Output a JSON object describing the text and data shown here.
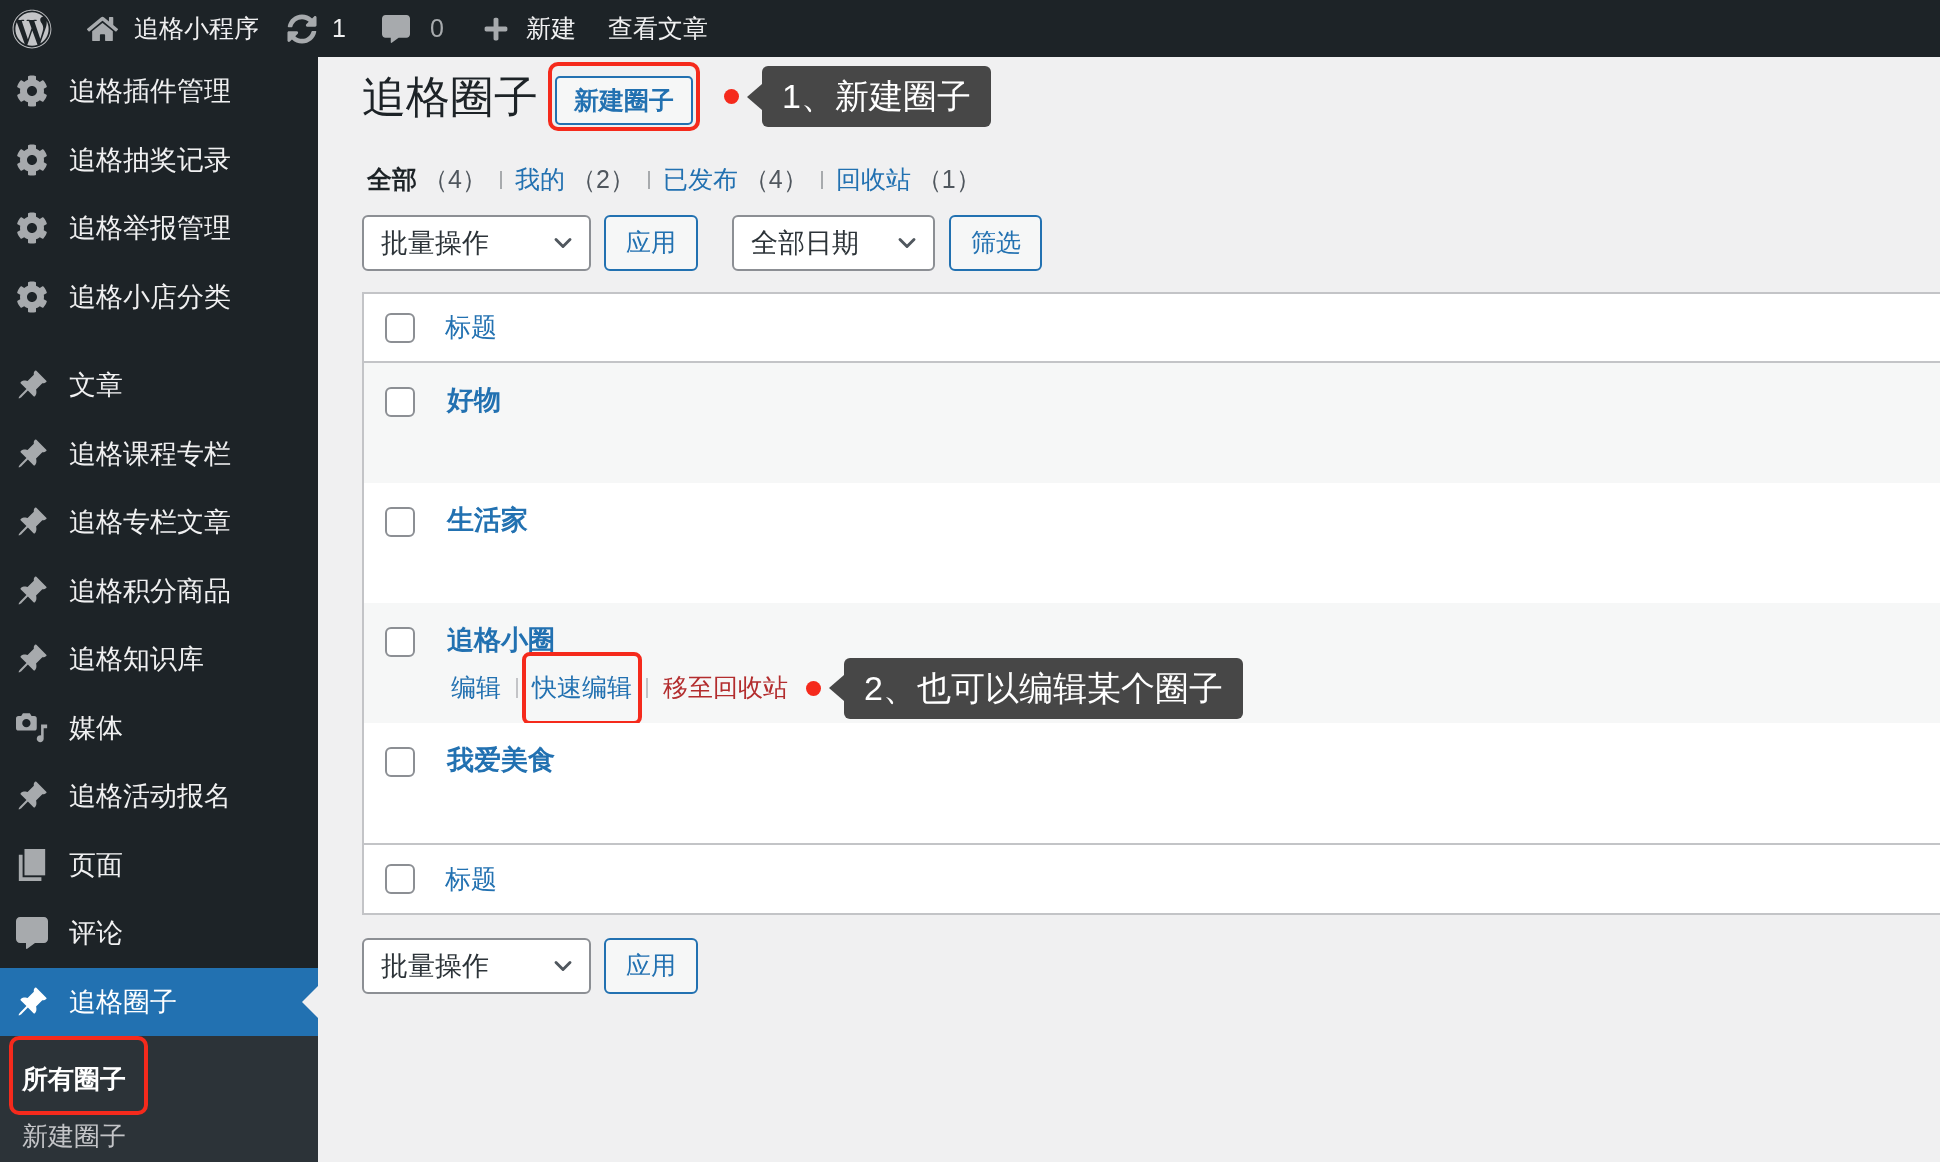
{
  "admin_bar": {
    "site_name": "追格小程序",
    "updates": "1",
    "comments": "0",
    "new": "新建",
    "view_posts": "查看文章"
  },
  "sidebar": {
    "groups": [
      {
        "items": [
          {
            "label": "追格插件管理",
            "kind": "gear",
            "selected": false
          },
          {
            "label": "追格抽奖记录",
            "kind": "gear",
            "selected": false
          },
          {
            "label": "追格举报管理",
            "kind": "gear",
            "selected": false
          },
          {
            "label": "追格小店分类",
            "kind": "gear",
            "selected": false
          }
        ]
      },
      {
        "items": [
          {
            "label": "文章",
            "kind": "pin",
            "selected": false
          },
          {
            "label": "追格课程专栏",
            "kind": "pin",
            "selected": false
          },
          {
            "label": "追格专栏文章",
            "kind": "pin",
            "selected": false
          },
          {
            "label": "追格积分商品",
            "kind": "pin",
            "selected": false
          },
          {
            "label": "追格知识库",
            "kind": "pin",
            "selected": false
          },
          {
            "label": "媒体",
            "kind": "media",
            "selected": false
          },
          {
            "label": "追格活动报名",
            "kind": "pin",
            "selected": false
          },
          {
            "label": "页面",
            "kind": "pages",
            "selected": false
          },
          {
            "label": "评论",
            "kind": "comments",
            "selected": false
          },
          {
            "label": "追格圈子",
            "kind": "pin",
            "selected": true,
            "children": [
              {
                "label": "所有圈子",
                "selected": true,
                "highlighted": true
              },
              {
                "label": "新建圈子",
                "selected": false,
                "highlighted": false
              }
            ]
          }
        ]
      }
    ]
  },
  "header": {
    "title": "追格圈子",
    "add_button": {
      "label": "新建圈子",
      "highlighted": true
    },
    "callout": "1、新建圈子"
  },
  "views": [
    {
      "label": "全部",
      "count": "（4）",
      "selected": true
    },
    {
      "label": "我的",
      "count": "（2）",
      "selected": false
    },
    {
      "label": "已发布",
      "count": "（4）",
      "selected": false
    },
    {
      "label": "回收站",
      "count": "（1）",
      "selected": false
    }
  ],
  "top_actions": {
    "bulk_select": "批量操作",
    "apply": "应用",
    "date_select": "全部日期",
    "filter": "筛选"
  },
  "table": {
    "header": {
      "label": "标题",
      "checked": false
    },
    "rows": [
      {
        "title": "好物",
        "checked": false
      },
      {
        "title": "生活家",
        "checked": false
      },
      {
        "title": "追格小圈",
        "checked": false,
        "actions": [
          {
            "label": "编辑",
            "kind": "link",
            "highlighted": false
          },
          {
            "label": "快速编辑",
            "kind": "link",
            "highlighted": true
          },
          {
            "label": "移至回收站",
            "kind": "delete",
            "highlighted": false
          }
        ],
        "callout": "2、也可以编辑某个圈子"
      },
      {
        "title": "我爱美食",
        "checked": false
      }
    ],
    "footer": {
      "label": "标题",
      "checked": false
    }
  },
  "bottom_actions": {
    "bulk_select": "批量操作",
    "apply": "应用"
  }
}
